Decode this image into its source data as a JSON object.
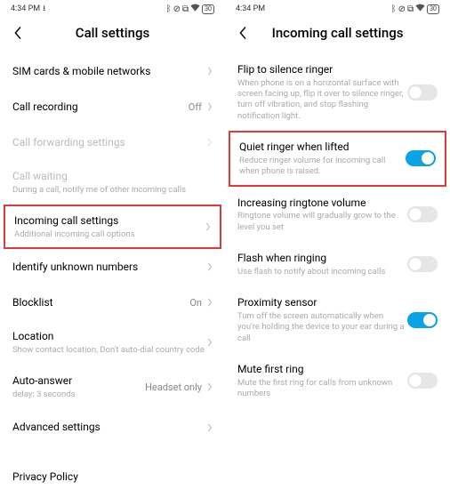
{
  "status": {
    "time": "4:34 PM",
    "icons": [
      "bluetooth-icon",
      "dnd-icon",
      "vibrate-icon",
      "wifi-icon",
      "battery-icon"
    ],
    "battery_label": "30"
  },
  "left": {
    "title": "Call settings",
    "rows": {
      "sim": {
        "title": "SIM cards & mobile networks"
      },
      "recording": {
        "title": "Call recording",
        "value": "Off"
      },
      "forwarding": {
        "title": "Call forwarding settings"
      },
      "waiting": {
        "title": "Call waiting",
        "sub": "During a call, notify me of other incoming calls"
      },
      "incoming": {
        "title": "Incoming call settings",
        "sub": "Additional incoming call options"
      },
      "identify": {
        "title": "Identify unknown numbers"
      },
      "blocklist": {
        "title": "Blocklist",
        "value": "On"
      },
      "location": {
        "title": "Location",
        "sub": "Show contact location, Don't auto-dial country code"
      },
      "autoanswer": {
        "title": "Auto-answer",
        "sub": "delay: 3 seconds",
        "value": "Headset only"
      },
      "advanced": {
        "title": "Advanced settings"
      }
    },
    "privacy": "Privacy Policy"
  },
  "right": {
    "title": "Incoming call settings",
    "rows": {
      "flip": {
        "title": "Flip to silence ringer",
        "sub": "When phone is on a horizontal surface with screen facing up, flip it over to silence ringer, turn off vibration, and stop flashing notification light.",
        "on": false
      },
      "quiet": {
        "title": "Quiet ringer when lifted",
        "sub": "Reduce ringer volume for incoming call when phone is raised.",
        "on": true
      },
      "increasing": {
        "title": "Increasing ringtone volume",
        "sub": "Ringtone volume will gradually grow to the level you set",
        "on": false
      },
      "flash": {
        "title": "Flash when ringing",
        "sub": "Use flash to notify about incoming calls",
        "on": false
      },
      "proximity": {
        "title": "Proximity sensor",
        "sub": "Turn off the screen automatically when you're holding the device to your ear during a call",
        "on": true
      },
      "mute": {
        "title": "Mute first ring",
        "sub": "Mute the first ring for calls from unknown numbers",
        "on": false
      }
    }
  },
  "colors": {
    "accent": "#0aa3e6",
    "highlight": "#e03a3a"
  }
}
